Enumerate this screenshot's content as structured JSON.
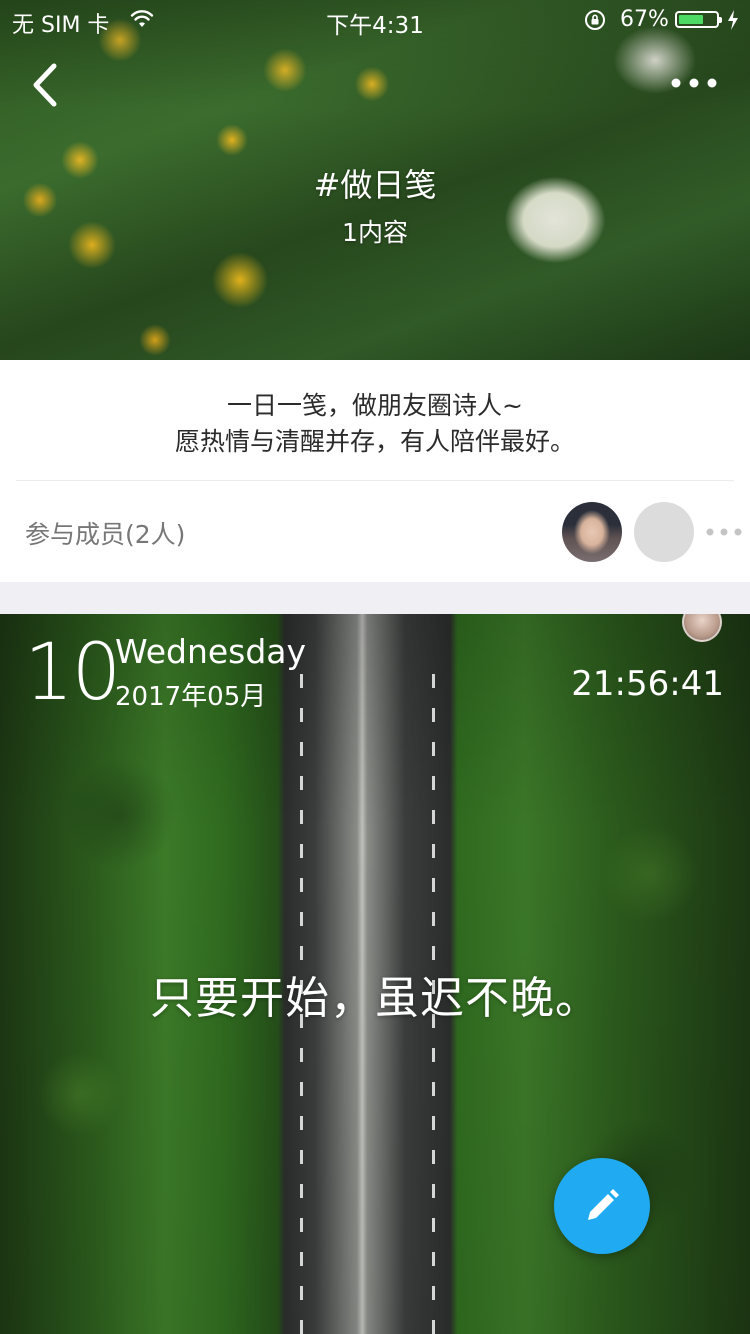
{
  "status_bar": {
    "carrier": "无 SIM 卡",
    "time": "下午4:31",
    "battery_percent": "67%",
    "battery_level": 0.67,
    "icons": [
      "wifi-icon",
      "orientation-lock-icon",
      "battery-icon",
      "charging-bolt-icon"
    ]
  },
  "header": {
    "title": "#做日笺",
    "content_count": "1内容",
    "icons": [
      "back-icon",
      "more-icon"
    ]
  },
  "description": {
    "line1": "一日一笺，做朋友圈诗人~",
    "line2": "愿热情与清醒并存，有人陪伴最好。"
  },
  "members": {
    "label": "参与成员(2人)",
    "count": 2
  },
  "card": {
    "day": "10",
    "weekday": "Wednesday",
    "month": "2017年05月",
    "time": "21:56:41",
    "quote": "只要开始，虽迟不晚。"
  },
  "fab": {
    "icon": "pencil-icon",
    "color": "#1faaf1"
  },
  "colors": {
    "accent": "#1faaf1",
    "battery_fill": "#4cd964"
  }
}
